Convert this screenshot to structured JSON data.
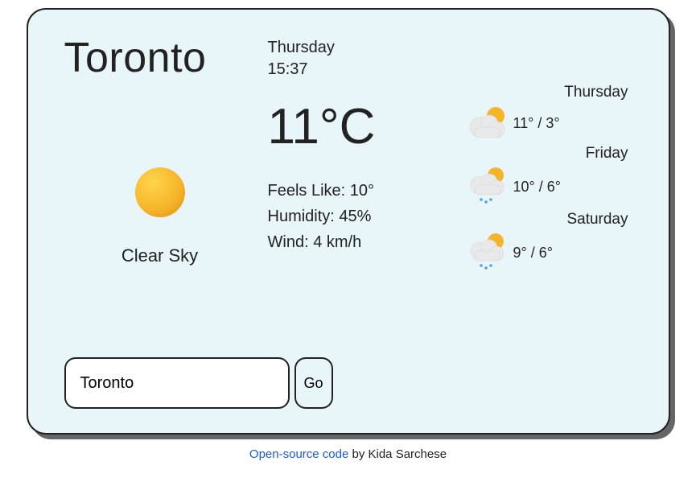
{
  "city": "Toronto",
  "date_day": "Thursday",
  "date_time": "15:37",
  "temp": "11°C",
  "condition": "Clear Sky",
  "details": {
    "feels_like_label": "Feels Like:",
    "feels_like_value": "10°",
    "humidity_label": "Humidity:",
    "humidity_value": "45%",
    "wind_label": "Wind:",
    "wind_value": "4 km/h"
  },
  "forecast": [
    {
      "day": "Thursday",
      "hi_lo": "11° / 3°",
      "icon": "partly-cloudy"
    },
    {
      "day": "Friday",
      "hi_lo": "10° / 6°",
      "icon": "rain-partly-cloudy"
    },
    {
      "day": "Saturday",
      "hi_lo": "9° / 6°",
      "icon": "rain-partly-cloudy"
    }
  ],
  "search": {
    "value": "Toronto",
    "button_label": "Go"
  },
  "footer": {
    "link_text": "Open-source code",
    "byline": " by Kida Sarchese"
  }
}
